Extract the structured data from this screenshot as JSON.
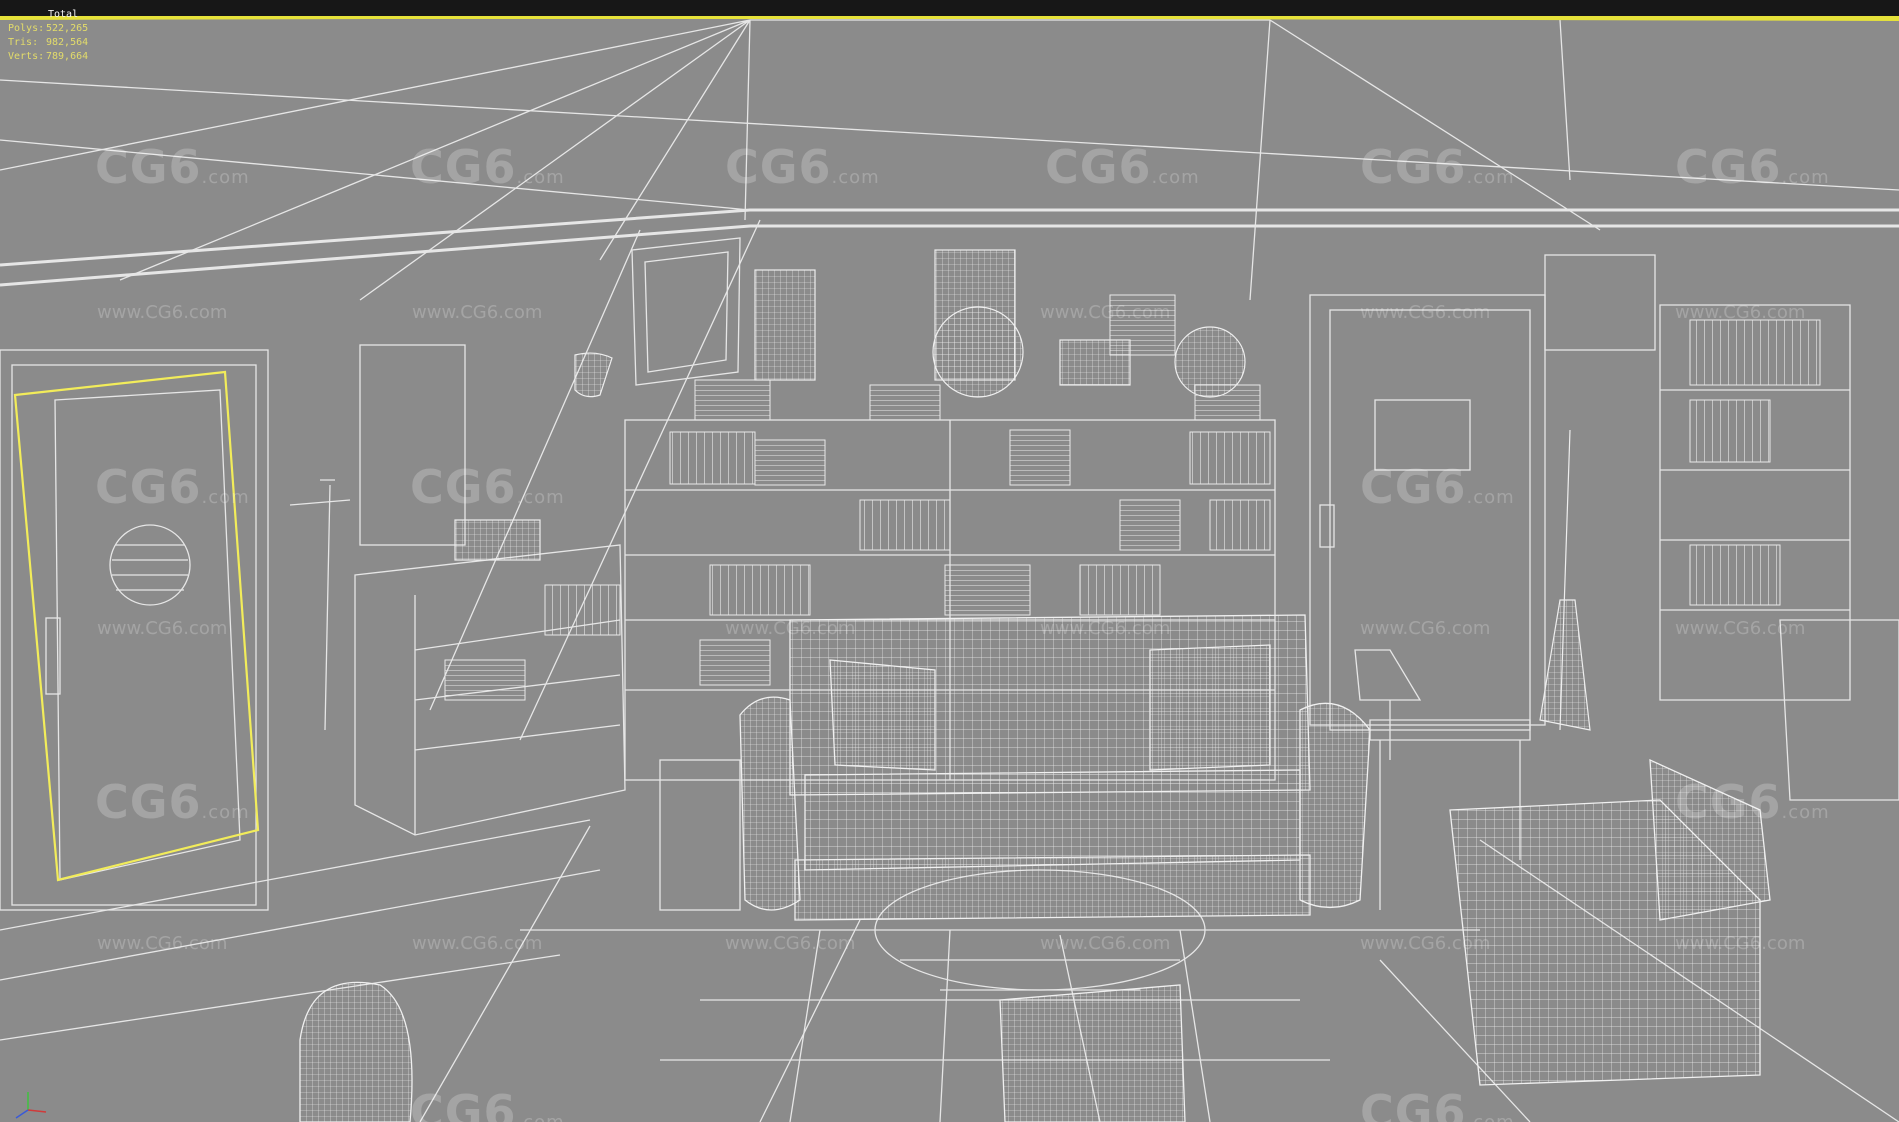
{
  "viewport": {
    "label": "Total",
    "stats": [
      {
        "key": "Polys:",
        "value": "522,265"
      },
      {
        "key": "Tris:",
        "value": "982,564"
      },
      {
        "key": "Verts:",
        "value": "789,664"
      }
    ]
  },
  "watermark": {
    "logo": "CG6",
    "logo_suffix": ".com",
    "url": "www.CG6.com"
  },
  "colors": {
    "background": "#8b8b8b",
    "wire": "#e8e8e8",
    "selection": "#f2ec5a",
    "topbar": "#171717"
  }
}
